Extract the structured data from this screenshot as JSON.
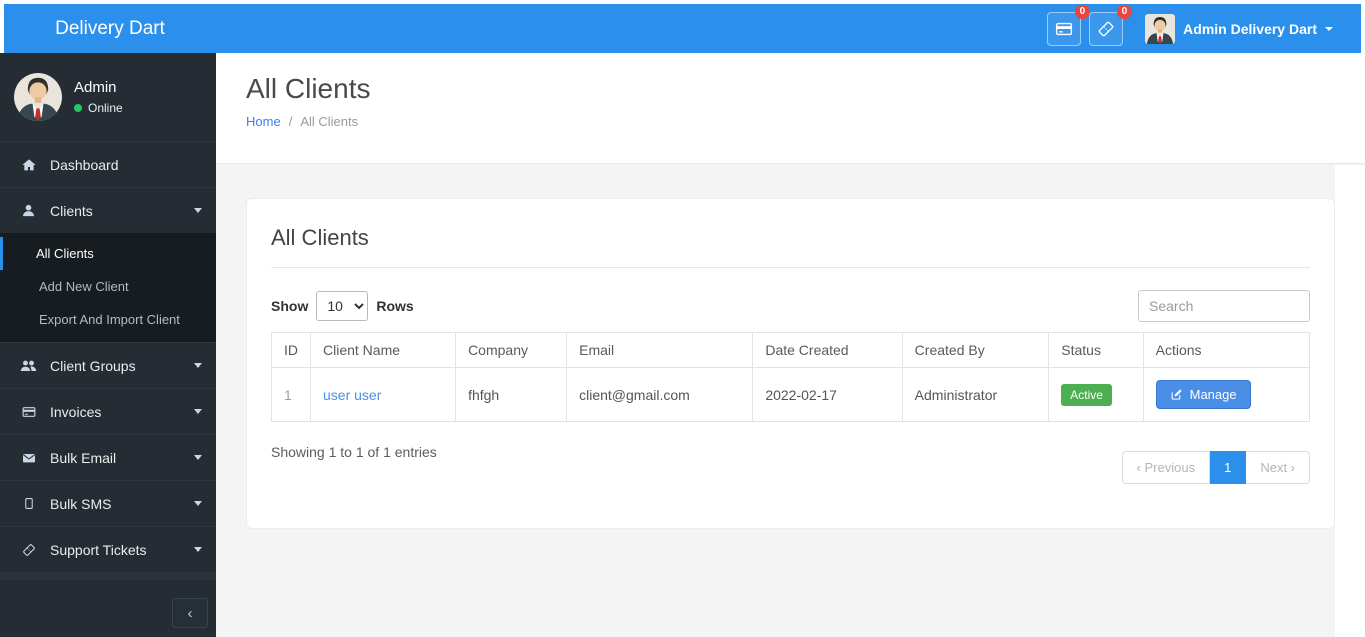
{
  "navbar": {
    "brand": "Delivery Dart",
    "notifications": [
      {
        "icon": "invoices-icon",
        "badge": "0"
      },
      {
        "icon": "ticket-icon",
        "badge": "0"
      }
    ],
    "user_label": "Admin Delivery Dart"
  },
  "sidebar": {
    "user": {
      "name": "Admin",
      "status": "Online"
    },
    "items": [
      {
        "label": "Dashboard",
        "icon": "home-icon"
      },
      {
        "label": "Clients",
        "icon": "user-icon",
        "expanded": true,
        "children": [
          "All Clients",
          "Add New Client",
          "Export And Import Client"
        ],
        "active_child": "All Clients"
      },
      {
        "label": "Client Groups",
        "icon": "users-icon"
      },
      {
        "label": "Invoices",
        "icon": "credit-card-icon"
      },
      {
        "label": "Bulk Email",
        "icon": "envelope-icon"
      },
      {
        "label": "Bulk SMS",
        "icon": "mobile-icon"
      },
      {
        "label": "Support Tickets",
        "icon": "ticket-icon"
      }
    ]
  },
  "page": {
    "title": "All Clients",
    "breadcrumb": {
      "home": "Home",
      "sep": "/",
      "current": "All Clients"
    }
  },
  "card": {
    "title": "All Clients",
    "show_label": "Show",
    "rows_label": "Rows",
    "page_size": "10",
    "search_placeholder": "Search",
    "table": {
      "headers": [
        "ID",
        "Client Name",
        "Company",
        "Email",
        "Date Created",
        "Created By",
        "Status",
        "Actions"
      ],
      "rows": [
        {
          "id": "1",
          "client_name": "user user",
          "company": "fhfgh",
          "email": "client@gmail.com",
          "date_created": "2022-02-17",
          "created_by": "Administrator",
          "status": "Active",
          "action": "Manage"
        }
      ]
    },
    "summary": "Showing 1 to 1 of 1 entries",
    "pagination": {
      "previous": "‹ Previous",
      "current": "1",
      "next": "Next ›"
    }
  },
  "colors": {
    "navbar_blue": "#2b90ec",
    "badge_red": "#e8463c",
    "status_green": "#4cb050",
    "link_blue": "#3b82ec",
    "sidebar_dark": "#252c33",
    "submenu_dark": "#161c20",
    "content_bg": "#f4f4f4"
  }
}
